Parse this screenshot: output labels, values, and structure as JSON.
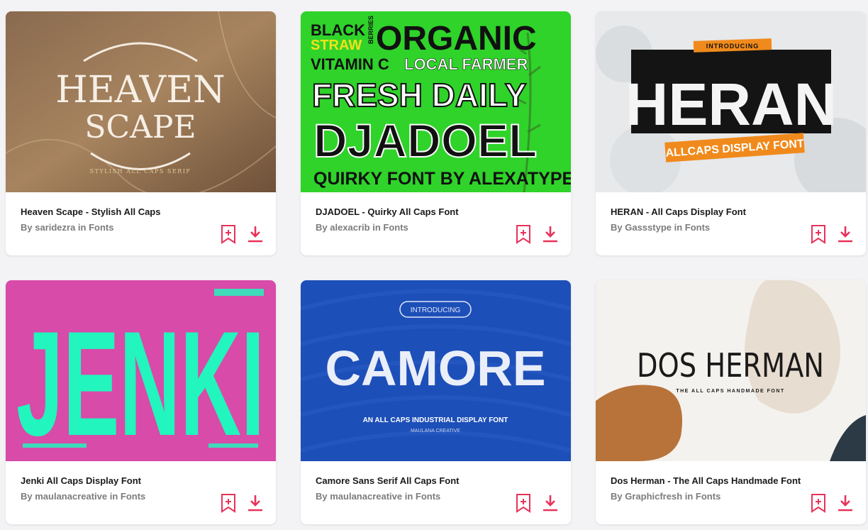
{
  "accent_color": "#e8325a",
  "cards": [
    {
      "title": "Heaven Scape - Stylish All Caps",
      "author": "By saridezra in Fonts",
      "preview": {
        "line1": "HEAVEN",
        "line2": "SCAPE",
        "tagline": "STYLISH ALL CAPS SERIF"
      }
    },
    {
      "title": "DJADOEL - Quirky All Caps Font",
      "author": "By alexacrib in Fonts",
      "preview": {
        "w1": "BLACK",
        "w2": "BERRIES",
        "w3": "STRAW",
        "w4": "ORGANIC",
        "w5": "VITAMIN C",
        "w6": "LOCAL FARMER",
        "w7": "FRESH DAILY",
        "w8": "DJADOEL",
        "w9": "QUIRKY FONT BY ALEXATYPE"
      }
    },
    {
      "title": "HERAN - All Caps Display Font",
      "author": "By Gassstype in Fonts",
      "preview": {
        "intro": "INTRODUCING",
        "name": "HERAN",
        "tagline": "ALLCAPS DISPLAY FONT"
      }
    },
    {
      "title": "Jenki All Caps Display Font",
      "author": "By maulanacreative in Fonts",
      "preview": {
        "name": "JENKI"
      }
    },
    {
      "title": "Camore Sans Serif All Caps Font",
      "author": "By maulanacreative in Fonts",
      "preview": {
        "intro": "INTRODUCING",
        "name": "CAMORE",
        "tagline": "AN ALL CAPS INDUSTRIAL DISPLAY FONT",
        "credit": "MAULANA CREATIVE"
      }
    },
    {
      "title": "Dos Herman - The All Caps Handmade Font",
      "author": "By Graphicfresh in Fonts",
      "preview": {
        "name": "DOS HERMAN",
        "tagline": "THE ALL CAPS HANDMADE FONT"
      }
    }
  ]
}
